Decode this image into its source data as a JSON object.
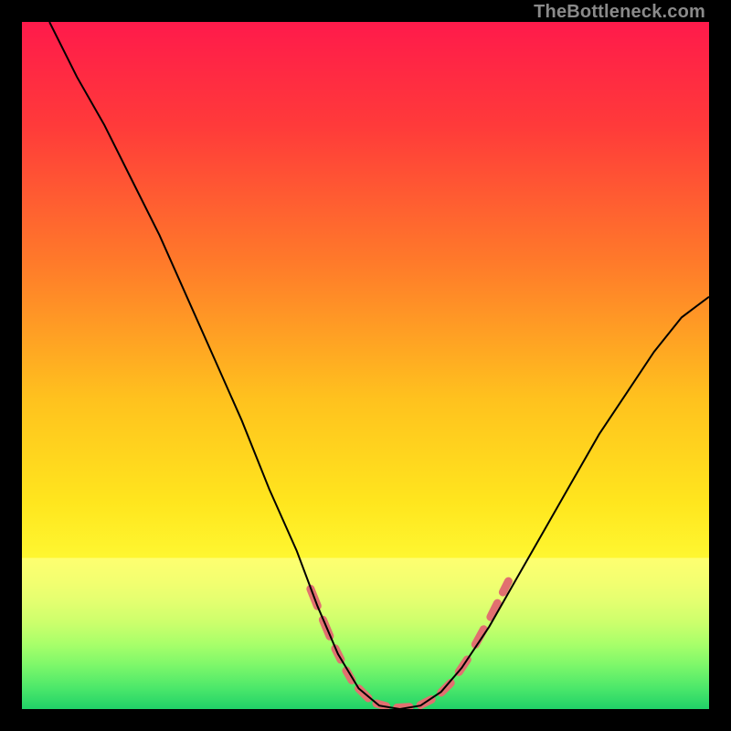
{
  "watermark": "TheBottleneck.com",
  "chart_data": {
    "type": "line",
    "title": "",
    "xlabel": "",
    "ylabel": "",
    "xlim": [
      0,
      100
    ],
    "ylim": [
      0,
      100
    ],
    "gradient_stops": [
      {
        "offset": 0.0,
        "color": "#ff1a4b"
      },
      {
        "offset": 0.15,
        "color": "#ff3a3a"
      },
      {
        "offset": 0.35,
        "color": "#ff7a2a"
      },
      {
        "offset": 0.55,
        "color": "#ffc21e"
      },
      {
        "offset": 0.7,
        "color": "#ffe61e"
      },
      {
        "offset": 0.82,
        "color": "#feff3a"
      },
      {
        "offset": 0.9,
        "color": "#e9ff6a"
      },
      {
        "offset": 0.95,
        "color": "#a8ff7a"
      },
      {
        "offset": 1.0,
        "color": "#20e070"
      }
    ],
    "bottom_band": {
      "start_y": 78,
      "colors": [
        "#feff70",
        "#f4ff70",
        "#e4ff70",
        "#ccff6c",
        "#a8ff6a",
        "#7cf76a",
        "#4de86a",
        "#20d268"
      ]
    },
    "series": [
      {
        "name": "bottleneck-curve",
        "stroke": "#000000",
        "stroke_width": 2,
        "points": [
          {
            "x": 4.0,
            "y": 100.0
          },
          {
            "x": 8.0,
            "y": 92.0
          },
          {
            "x": 12.0,
            "y": 85.0
          },
          {
            "x": 16.0,
            "y": 77.0
          },
          {
            "x": 20.0,
            "y": 69.0
          },
          {
            "x": 24.0,
            "y": 60.0
          },
          {
            "x": 28.0,
            "y": 51.0
          },
          {
            "x": 32.0,
            "y": 42.0
          },
          {
            "x": 36.0,
            "y": 32.0
          },
          {
            "x": 40.0,
            "y": 23.0
          },
          {
            "x": 43.0,
            "y": 15.0
          },
          {
            "x": 46.0,
            "y": 8.0
          },
          {
            "x": 49.0,
            "y": 3.0
          },
          {
            "x": 52.0,
            "y": 0.5
          },
          {
            "x": 55.0,
            "y": 0.0
          },
          {
            "x": 58.0,
            "y": 0.5
          },
          {
            "x": 61.0,
            "y": 2.5
          },
          {
            "x": 64.0,
            "y": 6.0
          },
          {
            "x": 68.0,
            "y": 12.0
          },
          {
            "x": 72.0,
            "y": 19.0
          },
          {
            "x": 76.0,
            "y": 26.0
          },
          {
            "x": 80.0,
            "y": 33.0
          },
          {
            "x": 84.0,
            "y": 40.0
          },
          {
            "x": 88.0,
            "y": 46.0
          },
          {
            "x": 92.0,
            "y": 52.0
          },
          {
            "x": 96.0,
            "y": 57.0
          },
          {
            "x": 100.0,
            "y": 60.0
          }
        ]
      },
      {
        "name": "highlight-dashes",
        "stroke": "#e17070",
        "stroke_width": 9,
        "segments": [
          {
            "x1": 42.0,
            "y1": 17.5,
            "x2": 43.0,
            "y2": 15.0
          },
          {
            "x1": 43.8,
            "y1": 13.0,
            "x2": 44.8,
            "y2": 10.6
          },
          {
            "x1": 45.6,
            "y1": 8.8,
            "x2": 46.4,
            "y2": 7.2
          },
          {
            "x1": 47.2,
            "y1": 5.6,
            "x2": 48.0,
            "y2": 4.2
          },
          {
            "x1": 49.0,
            "y1": 3.0,
            "x2": 50.4,
            "y2": 1.6
          },
          {
            "x1": 51.6,
            "y1": 0.8,
            "x2": 53.0,
            "y2": 0.4
          },
          {
            "x1": 54.6,
            "y1": 0.2,
            "x2": 56.4,
            "y2": 0.3
          },
          {
            "x1": 58.0,
            "y1": 0.6,
            "x2": 59.6,
            "y2": 1.4
          },
          {
            "x1": 61.0,
            "y1": 2.4,
            "x2": 62.4,
            "y2": 3.8
          },
          {
            "x1": 63.6,
            "y1": 5.4,
            "x2": 64.8,
            "y2": 7.2
          },
          {
            "x1": 66.0,
            "y1": 9.4,
            "x2": 67.2,
            "y2": 11.6
          },
          {
            "x1": 68.2,
            "y1": 13.4,
            "x2": 69.2,
            "y2": 15.4
          },
          {
            "x1": 70.0,
            "y1": 17.0,
            "x2": 70.8,
            "y2": 18.6
          }
        ]
      }
    ]
  }
}
